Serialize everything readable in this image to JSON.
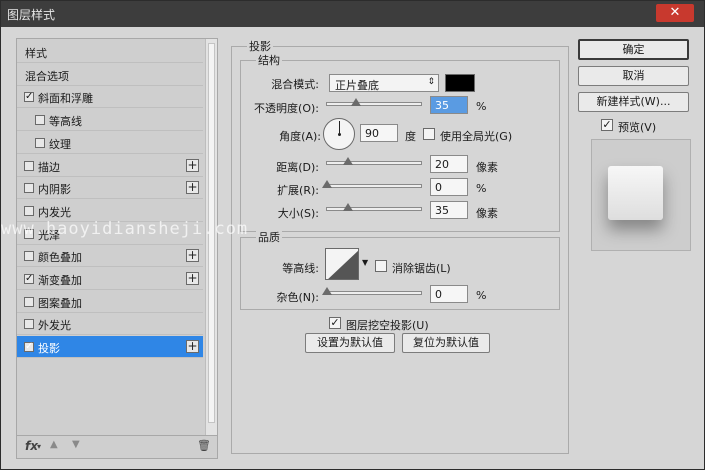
{
  "window": {
    "title": "图层样式",
    "close_glyph": "✕"
  },
  "left_panel": {
    "items": [
      {
        "label": "样式",
        "checkbox": false,
        "checked": false,
        "plus": false,
        "indent": false,
        "selected": false
      },
      {
        "label": "混合选项",
        "checkbox": false,
        "checked": false,
        "plus": false,
        "indent": false,
        "selected": false
      },
      {
        "label": "斜面和浮雕",
        "checkbox": true,
        "checked": true,
        "plus": false,
        "indent": false,
        "selected": false
      },
      {
        "label": "等高线",
        "checkbox": true,
        "checked": false,
        "plus": false,
        "indent": true,
        "selected": false
      },
      {
        "label": "纹理",
        "checkbox": true,
        "checked": false,
        "plus": false,
        "indent": true,
        "selected": false
      },
      {
        "label": "描边",
        "checkbox": true,
        "checked": false,
        "plus": true,
        "indent": false,
        "selected": false
      },
      {
        "label": "内阴影",
        "checkbox": true,
        "checked": false,
        "plus": true,
        "indent": false,
        "selected": false
      },
      {
        "label": "内发光",
        "checkbox": true,
        "checked": false,
        "plus": false,
        "indent": false,
        "selected": false
      },
      {
        "label": "光泽",
        "checkbox": true,
        "checked": false,
        "plus": false,
        "indent": false,
        "selected": false
      },
      {
        "label": "颜色叠加",
        "checkbox": true,
        "checked": false,
        "plus": true,
        "indent": false,
        "selected": false
      },
      {
        "label": "渐变叠加",
        "checkbox": true,
        "checked": true,
        "plus": true,
        "indent": false,
        "selected": false
      },
      {
        "label": "图案叠加",
        "checkbox": true,
        "checked": false,
        "plus": false,
        "indent": false,
        "selected": false
      },
      {
        "label": "外发光",
        "checkbox": true,
        "checked": false,
        "plus": false,
        "indent": false,
        "selected": false
      },
      {
        "label": "投影",
        "checkbox": true,
        "checked": true,
        "plus": true,
        "indent": false,
        "selected": true
      }
    ],
    "check_glyph": "✓",
    "plus_glyph": "+",
    "footer": {
      "fx": "fx",
      "fx_arrow": "▾",
      "up": "▲",
      "down": "▼",
      "trash": "🗑"
    }
  },
  "section": {
    "title": "投影",
    "structure": {
      "title": "结构",
      "blend_mode_label": "混合模式:",
      "blend_mode_value": "正片叠底",
      "blend_color": "#000000",
      "opacity_label": "不透明度(O):",
      "opacity_value": "35",
      "opacity_unit": "%",
      "angle_label": "角度(A):",
      "angle_value": "90",
      "angle_unit": "度",
      "global_light_label": "使用全局光(G)",
      "global_light_checked": false,
      "distance_label": "距离(D):",
      "distance_value": "20",
      "distance_unit": "像素",
      "spread_label": "扩展(R):",
      "spread_value": "0",
      "spread_unit": "%",
      "size_label": "大小(S):",
      "size_value": "35",
      "size_unit": "像素"
    },
    "quality": {
      "title": "品质",
      "contour_label": "等高线:",
      "antialias_label": "消除锯齿(L)",
      "antialias_checked": false,
      "noise_label": "杂色(N):",
      "noise_value": "0",
      "noise_unit": "%"
    },
    "knockout_label": "图层挖空投影(U)",
    "knockout_checked": true,
    "make_default": "设置为默认值",
    "reset_default": "复位为默认值"
  },
  "right": {
    "ok": "确定",
    "cancel": "取消",
    "new_style": "新建样式(W)...",
    "preview_label": "预览(V)",
    "preview_checked": true
  },
  "watermark": "www.haoyidiansheji.com"
}
